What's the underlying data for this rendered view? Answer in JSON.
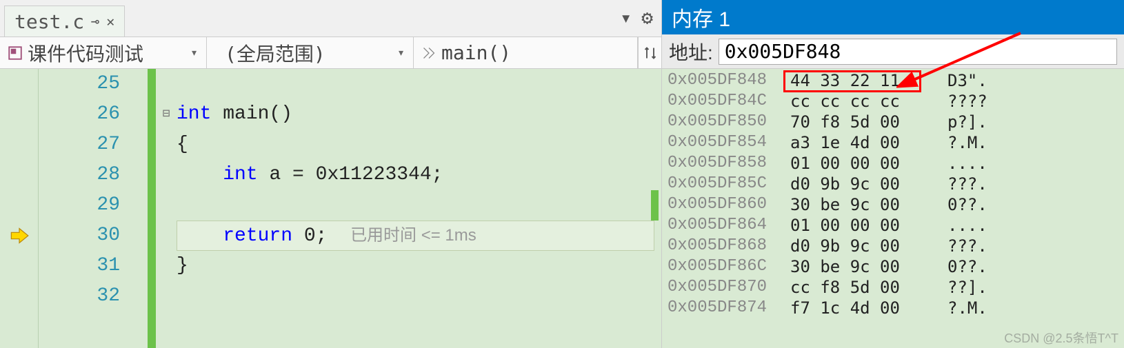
{
  "tab": {
    "filename": "test.c"
  },
  "nav": {
    "project": "课件代码测试",
    "scope": "(全局范围)",
    "func": "main()"
  },
  "code": {
    "first_line": 25,
    "lines": [
      {
        "n": 25,
        "text": ""
      },
      {
        "n": 26,
        "text": "int main()",
        "fold": "⊟"
      },
      {
        "n": 27,
        "text": "{"
      },
      {
        "n": 28,
        "text": "    int a = 0x11223344;"
      },
      {
        "n": 29,
        "text": ""
      },
      {
        "n": 30,
        "text": "    return 0;",
        "current": true,
        "hint": "已用时间 <= 1ms"
      },
      {
        "n": 31,
        "text": "}"
      },
      {
        "n": 32,
        "text": ""
      }
    ]
  },
  "memory": {
    "title": "内存 1",
    "address_label": "地址:",
    "address_value": "0x005DF848",
    "rows": [
      {
        "addr": "0x005DF848",
        "bytes": "44 33 22 11",
        "ascii": "D3\".",
        "highlight": true
      },
      {
        "addr": "0x005DF84C",
        "bytes": "cc cc cc cc",
        "ascii": "????"
      },
      {
        "addr": "0x005DF850",
        "bytes": "70 f8 5d 00",
        "ascii": "p?]."
      },
      {
        "addr": "0x005DF854",
        "bytes": "a3 1e 4d 00",
        "ascii": "?.M."
      },
      {
        "addr": "0x005DF858",
        "bytes": "01 00 00 00",
        "ascii": "...."
      },
      {
        "addr": "0x005DF85C",
        "bytes": "d0 9b 9c 00",
        "ascii": "???."
      },
      {
        "addr": "0x005DF860",
        "bytes": "30 be 9c 00",
        "ascii": "0??."
      },
      {
        "addr": "0x005DF864",
        "bytes": "01 00 00 00",
        "ascii": "...."
      },
      {
        "addr": "0x005DF868",
        "bytes": "d0 9b 9c 00",
        "ascii": "???."
      },
      {
        "addr": "0x005DF86C",
        "bytes": "30 be 9c 00",
        "ascii": "0??."
      },
      {
        "addr": "0x005DF870",
        "bytes": "cc f8 5d 00",
        "ascii": "??]."
      },
      {
        "addr": "0x005DF874",
        "bytes": "f7 1c 4d 00",
        "ascii": "?.M."
      }
    ]
  },
  "watermark": "CSDN @2.5条悟T^T"
}
